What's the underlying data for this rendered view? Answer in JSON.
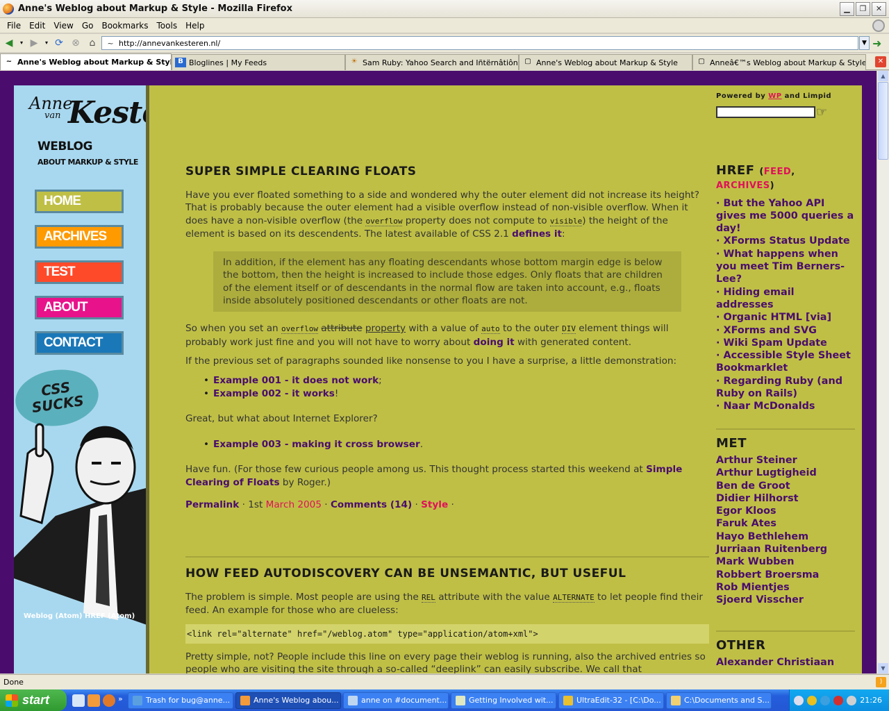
{
  "window": {
    "title": "Anne's Weblog about Markup & Style - Mozilla Firefox"
  },
  "menu": [
    "File",
    "Edit",
    "View",
    "Go",
    "Bookmarks",
    "Tools",
    "Help"
  ],
  "url": "http://annevankesteren.nl/",
  "tabs": [
    {
      "label": "Anne's Weblog about Markup & Style",
      "icon": "~"
    },
    {
      "label": "Bloglines | My Feeds",
      "icon": "B"
    },
    {
      "label": "Sam Ruby: Yahoo Search and Iñtërnâtiônàli...",
      "icon": "☀"
    },
    {
      "label": "Anne's Weblog about Markup & Style",
      "icon": "▢"
    },
    {
      "label": "Anneâ€™s Weblog about Markup & Style",
      "icon": "▢"
    }
  ],
  "logo": {
    "first": "Anne",
    "middle": "van",
    "last": "Kesteren",
    "weblog": "WEBLOG",
    "subtitle": "ABOUT MARKUP & STYLE"
  },
  "nav": [
    {
      "label": "HOME",
      "color": "#bfbf46"
    },
    {
      "label": "ARCHIVES",
      "color": "#ff9a00"
    },
    {
      "label": "TEST",
      "color": "#ff4a2a"
    },
    {
      "label": "ABOUT",
      "color": "#e8128a"
    },
    {
      "label": "CONTACT",
      "color": "#1a78b8"
    }
  ],
  "bubble": "CSS SUCKS",
  "left_footer": "Weblog (Atom) HREF (Atom)",
  "post1": {
    "title": "SUPER SIMPLE CLEARING FLOATS",
    "p1a": "Have you ever floated something to a side and wondered why the outer element did not increase its height? That is probably because the outer element had a visible overflow instead of non-visible overflow. When it does have a non-visible overflow (the ",
    "p1_code1": "overflow",
    "p1b": " property does not compute to ",
    "p1_code2": "visible",
    "p1c": ") the height of the element is based on its descendents. The latest available of CSS 2.1 ",
    "p1_link": "defines it",
    "p1d": ":",
    "quote": "In addition, if the element has any floating descendants whose bottom margin edge is below the bottom, then the height is increased to include those edges. Only floats that are children of the element itself or of descendants in the normal flow are taken into account, e.g., floats inside absolutely positioned descendants or other floats are not.",
    "p2a": "So when you set an ",
    "p2_code1": "overflow",
    "p2_strike": "attribute",
    "p2_ins": "property",
    "p2b": " with a value of ",
    "p2_code2": "auto",
    "p2c": " to the outer ",
    "p2_code3": "DIV",
    "p2d": " element things will probably work just fine and you will not have to worry about ",
    "p2_link": "doing it",
    "p2e": " with generated content.",
    "p3": "If the previous set of paragraphs sounded like nonsense to you I have a surprise, a little demonstration:",
    "ex1": "Example 001 - it does not work",
    "ex1_after": ";",
    "ex2": "Example 002 - it works",
    "ex2_after": "!",
    "p4": "Great, but what about Internet Explorer?",
    "ex3": "Example 003 - making it cross browser",
    "ex3_after": ".",
    "p5a": "Have fun. (For those few curious people among us. This thought process started this weekend at ",
    "p5_link": "Simple Clearing of Floats",
    "p5b": " by Roger.)",
    "meta_permalink": "Permalink",
    "meta_sep": " · ",
    "meta_date_pre": "1st ",
    "meta_date_link": "March 2005",
    "meta_comments": "Comments (14)",
    "meta_cat": "Style",
    "meta_end": " ·"
  },
  "post2": {
    "title": "HOW FEED AUTODISCOVERY CAN BE UNSEMANTIC, BUT USEFUL",
    "p1a": "The problem is simple. Most people are using the ",
    "p1_code1": "REL",
    "p1b": " attribute with the value ",
    "p1_code2": "ALTERNATE",
    "p1c": " to let people find their feed. An example for those who are clueless:",
    "code": "<link rel=\"alternate\" href=\"/weblog.atom\" type=\"application/atom+xml\">",
    "p2": "Pretty simple, not? People include this line on every page their weblog is running, also the archived entries so people who are visiting the site through a so-called “deeplink” can easily subscribe. We call that"
  },
  "sidebar": {
    "powered_pre": "Powered by ",
    "powered_wp": "WP",
    "powered_mid": " and ",
    "powered_limpid": "Limpid",
    "href_title": "HREF",
    "href_feed": "FEED",
    "href_archives": "ARCHIVES",
    "href_items": [
      "But the Yahoo API gives me 5000 queries a day!",
      "XForms Status Update",
      "What happens when you meet Tim Berners-Lee?",
      "Hiding email addresses",
      "Organic HTML [via]",
      "XForms and SVG",
      "Wiki Spam Update",
      "Accessible Style Sheet Bookmarklet",
      "Regarding Ruby (and Ruby on Rails)",
      "Naar McDonalds"
    ],
    "met_title": "MET",
    "met_items": [
      "Arthur Steiner",
      "Arthur Lugtigheid",
      "Ben de Groot",
      "Didier Hilhorst",
      "Egor Kloos",
      "Faruk Ates",
      "Hayo Bethlehem",
      "Jurriaan Ruitenberg",
      "Mark Wubben",
      "Robbert Broersma",
      "Rob Mientjes",
      "Sjoerd Visscher"
    ],
    "other_title": "OTHER",
    "other_items": [
      "Alexander Christiaan"
    ]
  },
  "status": "Done",
  "taskbar": {
    "start": "start",
    "tasks": [
      "Trash for bug@anne...",
      "Anne's Weblog abou...",
      "anne on #document...",
      "Getting Involved wit...",
      "UltraEdit-32 - [C:\\Do...",
      "C:\\Documents and S..."
    ],
    "clock": "21:26"
  }
}
